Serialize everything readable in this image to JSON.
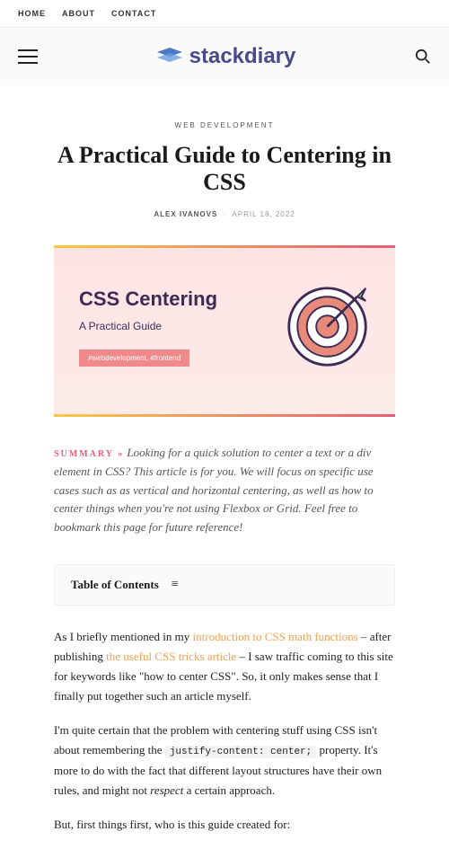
{
  "nav": {
    "items": [
      "HOME",
      "ABOUT",
      "CONTACT"
    ]
  },
  "brand": "stackdiary",
  "category": "WEB DEVELOPMENT",
  "title": "A Practical Guide to Centering in CSS",
  "author": "ALEX IVANOVS",
  "date": "APRIL 18, 2022",
  "hero": {
    "heading": "CSS Centering",
    "sub": "A Practical Guide",
    "tag": "#webdevelopment, #frontend"
  },
  "summary_label": "SUMMARY »",
  "summary": "Looking for a quick solution to center a text or a div element in CSS? This article is for you. We will focus on specific use cases such as as vertical and horizontal centering, as well as how to center things when you're not using Flexbox or Grid. Feel free to bookmark this page for future reference!",
  "toc_title": "Table of Contents",
  "body": {
    "p1_a": "As I briefly mentioned in my ",
    "p1_link1": "introduction to CSS math functions",
    "p1_b": " – after publishing ",
    "p1_link2": "the useful CSS tricks article",
    "p1_c": " – I saw traffic coming to this site for keywords like \"how to center CSS\". So, it only makes sense that I finally put together such an article myself.",
    "p2_a": "I'm quite certain that the problem with centering stuff using CSS isn't about remembering the ",
    "p2_code": "justify-content: center;",
    "p2_b": " property. It's more to do with the fact that different layout structures have their own rules, and might not ",
    "p2_em": "respect",
    "p2_c": " a certain approach.",
    "p3": "But, first things first, who is this guide created for:"
  }
}
